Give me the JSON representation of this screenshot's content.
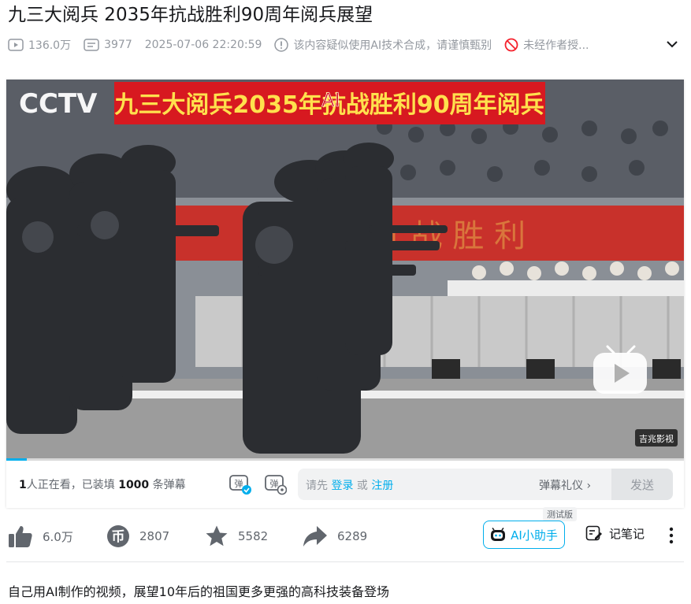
{
  "title": "九三大阅兵 2035年抗战胜利90周年阅兵展望",
  "meta": {
    "views": "136.0万",
    "danmaku_count": "3977",
    "date": "2025-07-06 22:20:59",
    "ai_warning": "该内容疑似使用AI技术合成，请谨慎甄别",
    "no_repost": "未经作者授..."
  },
  "video": {
    "channel_logo": "CCTV",
    "banner_text": "九三大阅兵2035年抗战胜利90周年阅兵",
    "ai_mark": "AI",
    "corner_watermark": "吉兆影视",
    "progress": 0.03,
    "accent": "#00aeec",
    "banner_color": "#d71920"
  },
  "danmaku_bar": {
    "watching_num": "1",
    "watching_text": "人正在看，已装填",
    "loaded_num": "1000",
    "loaded_text": "条弹幕",
    "placeholder_prefix": "请先",
    "login": "登录",
    "or": "或",
    "register": "注册",
    "etiquette": "弹幕礼仪 ›",
    "send": "发送"
  },
  "actions": {
    "like": "6.0万",
    "coin": "2807",
    "favorite": "5582",
    "share": "6289",
    "ai_assistant": "AI小助手",
    "beta": "测试版",
    "notes": "记笔记"
  },
  "description": "自己用AI制作的视频，展望10年后的祖国更多更强的高科技装备登场"
}
